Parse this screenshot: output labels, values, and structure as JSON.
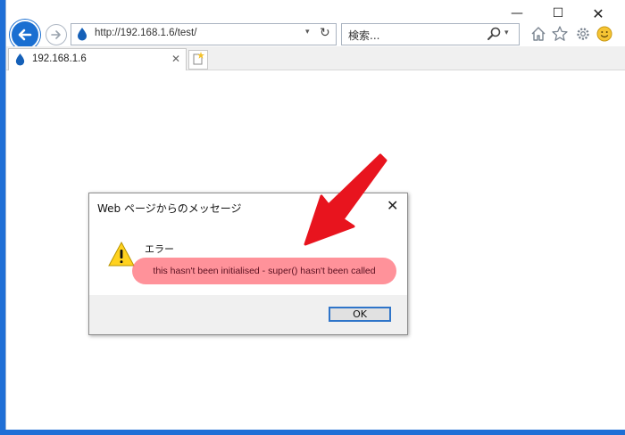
{
  "browser": {
    "window_controls": {
      "minimize": "—",
      "maximize": "☐",
      "close": "✕"
    },
    "address_bar": {
      "url": "http://192.168.1.6/test/",
      "dropdown": "▾",
      "refresh": "↻"
    },
    "search": {
      "placeholder": "検索...",
      "dropdown": "▾"
    },
    "tab": {
      "title": "192.168.1.6",
      "close": "✕"
    },
    "icons": [
      "back-arrow-icon",
      "forward-arrow-icon",
      "ie-logo-icon",
      "search-icon",
      "home-icon",
      "star-icon",
      "gear-icon",
      "smiley-icon",
      "new-tab-icon"
    ],
    "colors": {
      "accent": "#1a6fd1",
      "desktop": "#1f6fd6"
    }
  },
  "dialog": {
    "title": "Web ページからのメッセージ",
    "close": "✕",
    "heading": "エラー",
    "message": "this hasn't been initialised - super() hasn't been called",
    "ok_label": "OK",
    "colors": {
      "highlight": "#ff6e78",
      "annotation_arrow": "#e8141e"
    }
  }
}
